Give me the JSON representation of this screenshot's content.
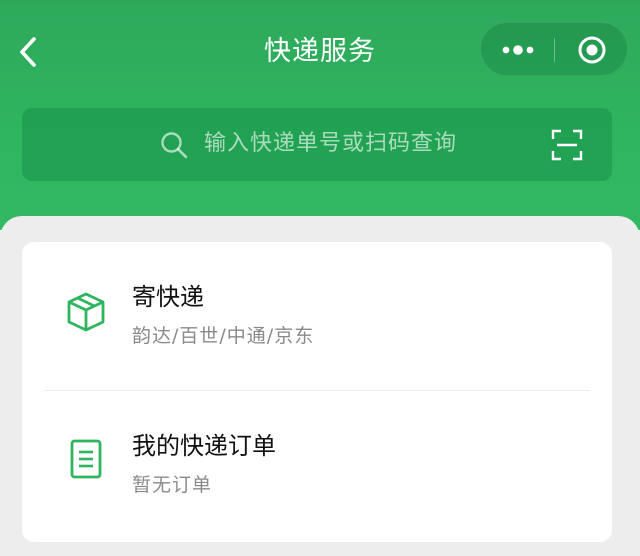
{
  "nav": {
    "title": "快递服务",
    "back_icon": "back-chevron-icon",
    "more_icon": "more-dots-icon",
    "close_icon": "close-circle-icon"
  },
  "search": {
    "placeholder": "输入快递单号或扫码查询",
    "search_icon": "search-icon",
    "scan_icon": "scan-icon"
  },
  "menu": {
    "items": [
      {
        "title": "寄快递",
        "subtitle": "韵达/百世/中通/京东",
        "icon": "package-box-icon"
      },
      {
        "title": "我的快递订单",
        "subtitle": "暂无订单",
        "icon": "order-document-icon"
      }
    ]
  },
  "colors": {
    "brand_green": "#2fb55f",
    "icon_green": "#2fb55f",
    "title_text": "#111111",
    "subtitle_text": "#8a8a8a",
    "background": "#ededed"
  }
}
